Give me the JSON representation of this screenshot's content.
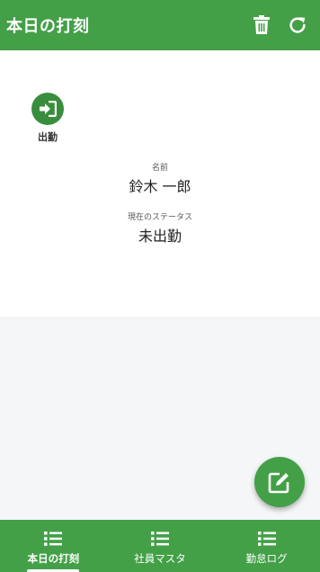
{
  "header": {
    "title": "本日の打刻",
    "trash_icon": "trash-icon",
    "refresh_icon": "refresh-icon"
  },
  "actions": {
    "clock_in": {
      "icon": "sign-in-icon",
      "label": "出勤"
    }
  },
  "employee": {
    "name_label": "名前",
    "name_value": "鈴木 一郎",
    "status_label": "現在のステータス",
    "status_value": "未出勤"
  },
  "fab": {
    "icon": "edit-icon"
  },
  "bottom_nav": {
    "items": [
      {
        "label": "本日の打刻",
        "icon": "list-icon",
        "active": true
      },
      {
        "label": "社員マスタ",
        "icon": "list-icon",
        "active": false
      },
      {
        "label": "勤怠ログ",
        "icon": "list-icon",
        "active": false
      }
    ]
  },
  "colors": {
    "primary": "#43a047",
    "dark_primary": "#388e3c"
  }
}
